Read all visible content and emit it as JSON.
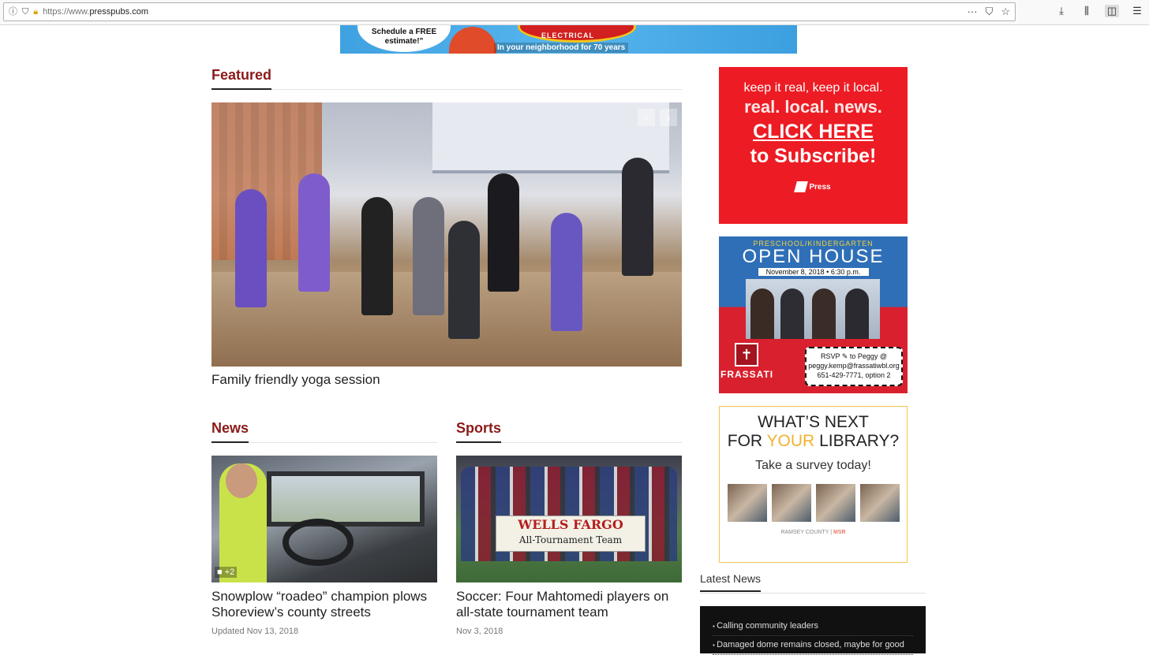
{
  "browser": {
    "url_proto": "https://www.",
    "url_domain": "presspubs.com",
    "more_icon": "···",
    "pocket_icon": "pocket-icon",
    "bookmark_icon": "star-icon"
  },
  "top_ad": {
    "bubble": "Schedule a FREE estimate!\"",
    "logo": "ELECTRICAL",
    "tagline": "In your neighborhood for 70 years"
  },
  "featured": {
    "heading": "Featured",
    "caption": "Family friendly yoga session",
    "prev": "‹",
    "next": "›"
  },
  "news": {
    "heading": "News",
    "badge": "+2",
    "title": "Snowplow “roadeo” champion plows Shoreview’s county streets",
    "date": "Updated Nov 13, 2018"
  },
  "sports": {
    "heading": "Sports",
    "banner_1": "WELLS FARGO",
    "banner_2": "All-Tournament Team",
    "title": "Soccer: Four Mahtomedi players on all-state tournament team",
    "date": "Nov 3, 2018"
  },
  "ads": {
    "subscribe": {
      "l1": "keep it real, keep it local.",
      "l2": "real. local. news.",
      "l3": "CLICK HERE",
      "l4": "to Subscribe!",
      "brand": "Press"
    },
    "openhouse": {
      "t1": "PRESCHOOL/KINDERGARTEN",
      "t2": "OPEN HOUSE",
      "t3": "November 8, 2018 • 6:30 p.m.",
      "school": "FRASSATI",
      "rsvp_1": "RSVP ✎ to Peggy @",
      "rsvp_2": "peggy.kemp@frassatiwbl.org",
      "rsvp_3": "651-429-7771, option 2"
    },
    "library": {
      "h1a": "WHAT’S NEXT",
      "h1b_pre": "FOR ",
      "h1b_y": "YOUR",
      "h1b_post": " LIBRARY?",
      "h2": "Take a survey today!",
      "foot_a": "RAMSEY COUNTY",
      "foot_b": "MSR"
    }
  },
  "latest": {
    "heading": "Latest News",
    "items": [
      "Calling community leaders",
      "Damaged dome remains closed, maybe for good"
    ]
  }
}
